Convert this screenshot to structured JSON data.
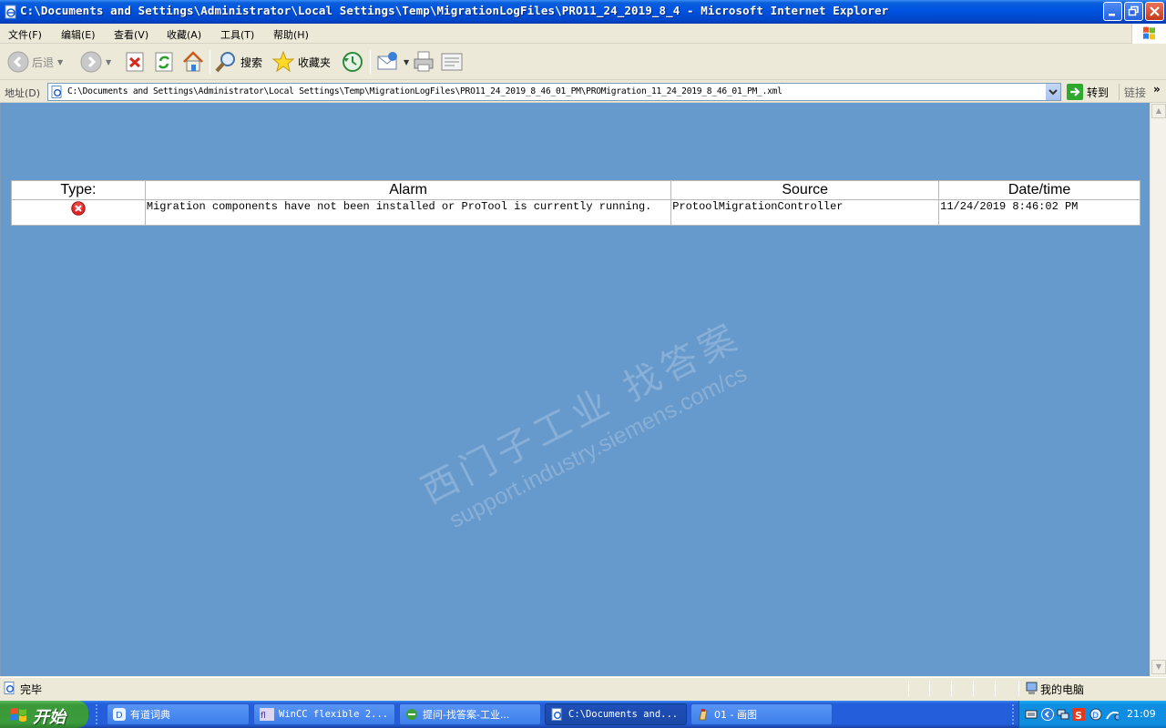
{
  "window": {
    "title": "C:\\Documents and Settings\\Administrator\\Local Settings\\Temp\\MigrationLogFiles\\PRO11_24_2019_8_4 - Microsoft Internet Explorer"
  },
  "menu": {
    "items": [
      "文件(F)",
      "编辑(E)",
      "查看(V)",
      "收藏(A)",
      "工具(T)",
      "帮助(H)"
    ]
  },
  "toolbar": {
    "back_label": "后退",
    "search_label": "搜索",
    "favorites_label": "收藏夹",
    "icons": [
      "back-icon",
      "forward-icon",
      "stop-icon",
      "refresh-icon",
      "home-icon",
      "search-icon",
      "favorites-icon",
      "history-icon",
      "mail-icon",
      "print-icon",
      "edit-icon"
    ]
  },
  "address": {
    "label": "地址(D)",
    "url": "C:\\Documents and Settings\\Administrator\\Local Settings\\Temp\\MigrationLogFiles\\PRO11_24_2019_8_46_01_PM\\PROMigration_11_24_2019_8_46_01_PM_.xml",
    "go_label": "转到",
    "links_label": "链接",
    "links_more": "»"
  },
  "content": {
    "background": "#6699cc",
    "table": {
      "headers": [
        "Type:",
        "Alarm",
        "Source",
        "Date/time"
      ],
      "rows": [
        {
          "type_icon": "error-icon",
          "alarm": "Migration components have not been installed or ProTool is currently running.",
          "source": "ProtoolMigrationController",
          "datetime": "11/24/2019 8:46:02 PM"
        }
      ]
    },
    "watermark": {
      "line1": "西门子工业  找答案",
      "line2": "support.industry.siemens.com/cs"
    }
  },
  "status": {
    "text": "完毕",
    "zone": "我的电脑"
  },
  "taskbar": {
    "start_label": "开始",
    "tasks": [
      {
        "label": "有道词典",
        "active": false
      },
      {
        "label": "WinCC flexible 2...",
        "active": false
      },
      {
        "label": "提问-找答案-工业...",
        "active": false
      },
      {
        "label": "C:\\Documents and...",
        "active": true
      },
      {
        "label": "01 - 画图",
        "active": false
      }
    ],
    "clock": "21:09"
  }
}
